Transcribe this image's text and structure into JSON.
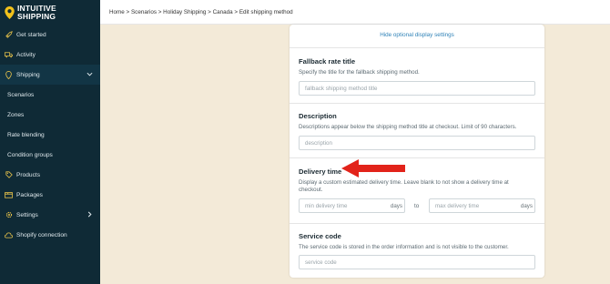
{
  "brand": {
    "line1": "INTUITIVE",
    "line2": "SHIPPING"
  },
  "sidebar": {
    "items": [
      {
        "label": "Get started",
        "icon": "rocket-icon"
      },
      {
        "label": "Activity",
        "icon": "truck-icon"
      },
      {
        "label": "Shipping",
        "icon": "map-pin-icon",
        "expanded": true
      },
      {
        "label": "Scenarios"
      },
      {
        "label": "Zones"
      },
      {
        "label": "Rate blending"
      },
      {
        "label": "Condition groups"
      },
      {
        "label": "Products",
        "icon": "tag-icon"
      },
      {
        "label": "Packages",
        "icon": "box-icon"
      },
      {
        "label": "Settings",
        "icon": "gear-icon"
      },
      {
        "label": "Shopify connection",
        "icon": "cloud-icon"
      }
    ]
  },
  "breadcrumb": "Home > Scenarios > Holiday Shipping > Canada > Edit shipping method",
  "form": {
    "hide_link": "Hide optional display settings",
    "fallback": {
      "title": "Fallback rate title",
      "help": "Specify the title for the fallback shipping method.",
      "placeholder": "fallback shipping method title"
    },
    "description": {
      "title": "Description",
      "help": "Descriptions appear below the shipping method title at checkout. Limit of 90 characters.",
      "placeholder": "description"
    },
    "delivery": {
      "title": "Delivery time",
      "help": "Display a custom estimated delivery time. Leave blank to not show a delivery time at checkout.",
      "min_placeholder": "min delivery time",
      "max_placeholder": "max delivery time",
      "suffix": "days",
      "to": "to"
    },
    "service": {
      "title": "Service code",
      "help": "The service code is stored in the order information and is not visible to the customer.",
      "placeholder": "service code"
    }
  },
  "colors": {
    "sidebar": "#0f2a36",
    "accent": "#f2c21b",
    "arrow": "#e2231a",
    "link": "#2f82b7",
    "background": "#f3ead8"
  }
}
